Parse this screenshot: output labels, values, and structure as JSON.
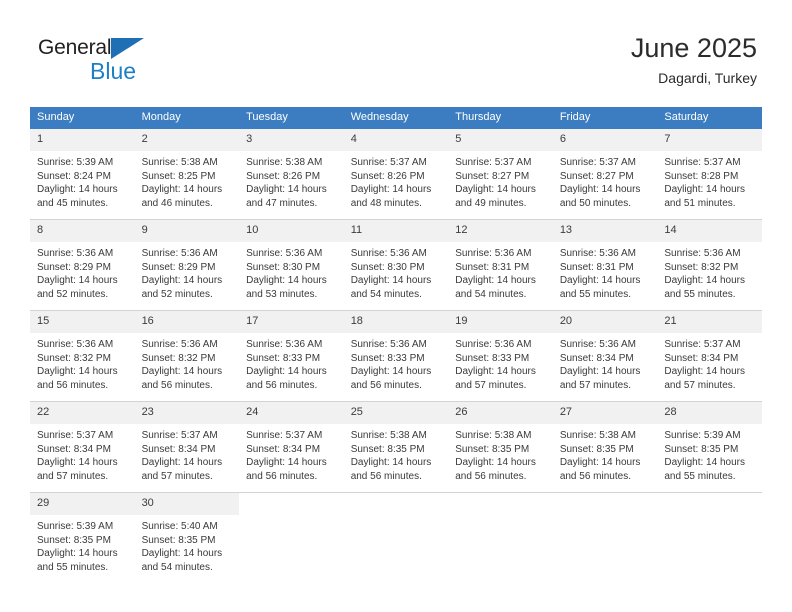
{
  "brand": {
    "name_top": "General",
    "name_bottom": "Blue",
    "color_dark": "#231f20",
    "color_blue": "#1f7fc4",
    "triangle_color": "#1f6fb5"
  },
  "header": {
    "title": "June 2025",
    "subtitle": "Dagardi, Turkey"
  },
  "theme": {
    "header_bg": "#3b7dc0",
    "header_text": "#ffffff",
    "daynum_bg": "#f1f1f1",
    "cell_bg": "#ffffff",
    "row_divider": "#d3d3d3"
  },
  "weekday_headers": [
    "Sunday",
    "Monday",
    "Tuesday",
    "Wednesday",
    "Thursday",
    "Friday",
    "Saturday"
  ],
  "weeks": [
    [
      {
        "day": "1",
        "sunrise": "Sunrise: 5:39 AM",
        "sunset": "Sunset: 8:24 PM",
        "daylight_1": "Daylight: 14 hours",
        "daylight_2": "and 45 minutes."
      },
      {
        "day": "2",
        "sunrise": "Sunrise: 5:38 AM",
        "sunset": "Sunset: 8:25 PM",
        "daylight_1": "Daylight: 14 hours",
        "daylight_2": "and 46 minutes."
      },
      {
        "day": "3",
        "sunrise": "Sunrise: 5:38 AM",
        "sunset": "Sunset: 8:26 PM",
        "daylight_1": "Daylight: 14 hours",
        "daylight_2": "and 47 minutes."
      },
      {
        "day": "4",
        "sunrise": "Sunrise: 5:37 AM",
        "sunset": "Sunset: 8:26 PM",
        "daylight_1": "Daylight: 14 hours",
        "daylight_2": "and 48 minutes."
      },
      {
        "day": "5",
        "sunrise": "Sunrise: 5:37 AM",
        "sunset": "Sunset: 8:27 PM",
        "daylight_1": "Daylight: 14 hours",
        "daylight_2": "and 49 minutes."
      },
      {
        "day": "6",
        "sunrise": "Sunrise: 5:37 AM",
        "sunset": "Sunset: 8:27 PM",
        "daylight_1": "Daylight: 14 hours",
        "daylight_2": "and 50 minutes."
      },
      {
        "day": "7",
        "sunrise": "Sunrise: 5:37 AM",
        "sunset": "Sunset: 8:28 PM",
        "daylight_1": "Daylight: 14 hours",
        "daylight_2": "and 51 minutes."
      }
    ],
    [
      {
        "day": "8",
        "sunrise": "Sunrise: 5:36 AM",
        "sunset": "Sunset: 8:29 PM",
        "daylight_1": "Daylight: 14 hours",
        "daylight_2": "and 52 minutes."
      },
      {
        "day": "9",
        "sunrise": "Sunrise: 5:36 AM",
        "sunset": "Sunset: 8:29 PM",
        "daylight_1": "Daylight: 14 hours",
        "daylight_2": "and 52 minutes."
      },
      {
        "day": "10",
        "sunrise": "Sunrise: 5:36 AM",
        "sunset": "Sunset: 8:30 PM",
        "daylight_1": "Daylight: 14 hours",
        "daylight_2": "and 53 minutes."
      },
      {
        "day": "11",
        "sunrise": "Sunrise: 5:36 AM",
        "sunset": "Sunset: 8:30 PM",
        "daylight_1": "Daylight: 14 hours",
        "daylight_2": "and 54 minutes."
      },
      {
        "day": "12",
        "sunrise": "Sunrise: 5:36 AM",
        "sunset": "Sunset: 8:31 PM",
        "daylight_1": "Daylight: 14 hours",
        "daylight_2": "and 54 minutes."
      },
      {
        "day": "13",
        "sunrise": "Sunrise: 5:36 AM",
        "sunset": "Sunset: 8:31 PM",
        "daylight_1": "Daylight: 14 hours",
        "daylight_2": "and 55 minutes."
      },
      {
        "day": "14",
        "sunrise": "Sunrise: 5:36 AM",
        "sunset": "Sunset: 8:32 PM",
        "daylight_1": "Daylight: 14 hours",
        "daylight_2": "and 55 minutes."
      }
    ],
    [
      {
        "day": "15",
        "sunrise": "Sunrise: 5:36 AM",
        "sunset": "Sunset: 8:32 PM",
        "daylight_1": "Daylight: 14 hours",
        "daylight_2": "and 56 minutes."
      },
      {
        "day": "16",
        "sunrise": "Sunrise: 5:36 AM",
        "sunset": "Sunset: 8:32 PM",
        "daylight_1": "Daylight: 14 hours",
        "daylight_2": "and 56 minutes."
      },
      {
        "day": "17",
        "sunrise": "Sunrise: 5:36 AM",
        "sunset": "Sunset: 8:33 PM",
        "daylight_1": "Daylight: 14 hours",
        "daylight_2": "and 56 minutes."
      },
      {
        "day": "18",
        "sunrise": "Sunrise: 5:36 AM",
        "sunset": "Sunset: 8:33 PM",
        "daylight_1": "Daylight: 14 hours",
        "daylight_2": "and 56 minutes."
      },
      {
        "day": "19",
        "sunrise": "Sunrise: 5:36 AM",
        "sunset": "Sunset: 8:33 PM",
        "daylight_1": "Daylight: 14 hours",
        "daylight_2": "and 57 minutes."
      },
      {
        "day": "20",
        "sunrise": "Sunrise: 5:36 AM",
        "sunset": "Sunset: 8:34 PM",
        "daylight_1": "Daylight: 14 hours",
        "daylight_2": "and 57 minutes."
      },
      {
        "day": "21",
        "sunrise": "Sunrise: 5:37 AM",
        "sunset": "Sunset: 8:34 PM",
        "daylight_1": "Daylight: 14 hours",
        "daylight_2": "and 57 minutes."
      }
    ],
    [
      {
        "day": "22",
        "sunrise": "Sunrise: 5:37 AM",
        "sunset": "Sunset: 8:34 PM",
        "daylight_1": "Daylight: 14 hours",
        "daylight_2": "and 57 minutes."
      },
      {
        "day": "23",
        "sunrise": "Sunrise: 5:37 AM",
        "sunset": "Sunset: 8:34 PM",
        "daylight_1": "Daylight: 14 hours",
        "daylight_2": "and 57 minutes."
      },
      {
        "day": "24",
        "sunrise": "Sunrise: 5:37 AM",
        "sunset": "Sunset: 8:34 PM",
        "daylight_1": "Daylight: 14 hours",
        "daylight_2": "and 56 minutes."
      },
      {
        "day": "25",
        "sunrise": "Sunrise: 5:38 AM",
        "sunset": "Sunset: 8:35 PM",
        "daylight_1": "Daylight: 14 hours",
        "daylight_2": "and 56 minutes."
      },
      {
        "day": "26",
        "sunrise": "Sunrise: 5:38 AM",
        "sunset": "Sunset: 8:35 PM",
        "daylight_1": "Daylight: 14 hours",
        "daylight_2": "and 56 minutes."
      },
      {
        "day": "27",
        "sunrise": "Sunrise: 5:38 AM",
        "sunset": "Sunset: 8:35 PM",
        "daylight_1": "Daylight: 14 hours",
        "daylight_2": "and 56 minutes."
      },
      {
        "day": "28",
        "sunrise": "Sunrise: 5:39 AM",
        "sunset": "Sunset: 8:35 PM",
        "daylight_1": "Daylight: 14 hours",
        "daylight_2": "and 55 minutes."
      }
    ],
    [
      {
        "day": "29",
        "sunrise": "Sunrise: 5:39 AM",
        "sunset": "Sunset: 8:35 PM",
        "daylight_1": "Daylight: 14 hours",
        "daylight_2": "and 55 minutes."
      },
      {
        "day": "30",
        "sunrise": "Sunrise: 5:40 AM",
        "sunset": "Sunset: 8:35 PM",
        "daylight_1": "Daylight: 14 hours",
        "daylight_2": "and 54 minutes."
      },
      {
        "day": "",
        "sunrise": "",
        "sunset": "",
        "daylight_1": "",
        "daylight_2": "",
        "empty": true
      },
      {
        "day": "",
        "sunrise": "",
        "sunset": "",
        "daylight_1": "",
        "daylight_2": "",
        "empty": true
      },
      {
        "day": "",
        "sunrise": "",
        "sunset": "",
        "daylight_1": "",
        "daylight_2": "",
        "empty": true
      },
      {
        "day": "",
        "sunrise": "",
        "sunset": "",
        "daylight_1": "",
        "daylight_2": "",
        "empty": true
      },
      {
        "day": "",
        "sunrise": "",
        "sunset": "",
        "daylight_1": "",
        "daylight_2": "",
        "empty": true
      }
    ]
  ]
}
